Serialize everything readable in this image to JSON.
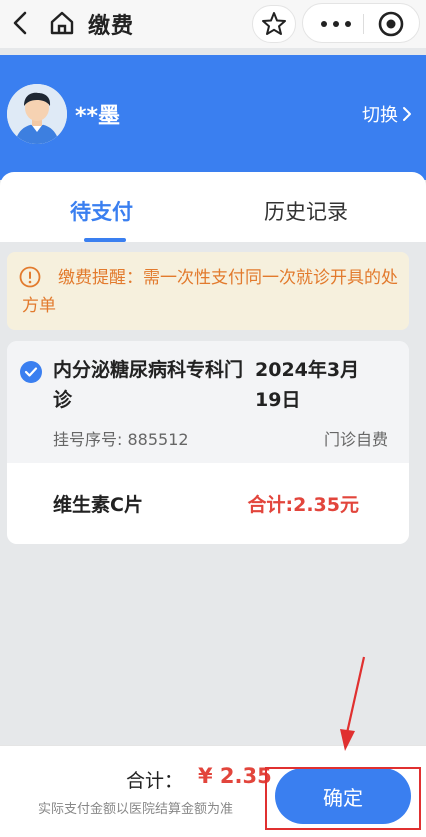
{
  "nav": {
    "title": "缴费",
    "icons": [
      "back-icon",
      "home-icon",
      "star-icon",
      "more-icon",
      "target-icon"
    ]
  },
  "header": {
    "user_name": "**墨",
    "switch_label": "切换"
  },
  "tabs": [
    {
      "label": "待支付",
      "active": true
    },
    {
      "label": "历史记录",
      "active": false
    }
  ],
  "notice": {
    "text": "缴费提醒：需一次性支付同一次就诊开具的处方单"
  },
  "prescription": {
    "department": "内分泌糖尿病科专科门诊",
    "date": "2024年3月19日",
    "registration": "挂号序号: 885512",
    "payment_type": "门诊自费",
    "drug_name": "维生素C片",
    "drug_total": "合计:2.35元",
    "selected": true
  },
  "footer": {
    "total_label": "合计：",
    "total_amount": "¥ 2.35",
    "disclaimer": "实际支付金额以医院结算金额为准",
    "confirm_label": "确定"
  },
  "colors": {
    "brand": "#3a7ff0",
    "price": "#e2453c",
    "notice_text": "#e27a2d",
    "notice_bg": "#f6f0dd",
    "annotation": "#e03030"
  }
}
